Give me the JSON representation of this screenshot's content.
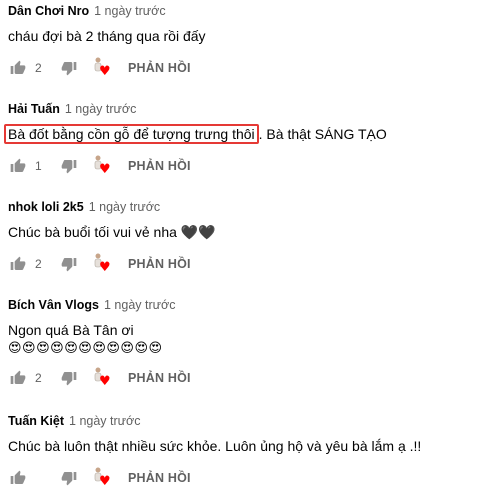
{
  "comments": [
    {
      "author": "Dân Chơi Nro",
      "time": "1 ngày trước",
      "text": "cháu đợi bà 2 tháng qua rồi đấy",
      "likes": "2",
      "reply_label": "PHẢN HỒI"
    },
    {
      "author": "Hải Tuấn",
      "time": "1 ngày trước",
      "text_highlighted": "Bà đốt bằng cồn  gỗ để tượng trưng thôi",
      "text_rest": ". Bà thật SÁNG TẠO",
      "highlight_color": "#e53935",
      "likes": "1",
      "reply_label": "PHẢN HỒI"
    },
    {
      "author": "nhok loli 2k5",
      "time": "1 ngày trước",
      "text": "Chúc bà buổi tối vui vẻ nha 🖤🖤",
      "likes": "2",
      "reply_label": "PHẢN HỒI"
    },
    {
      "author": "Bích Vân Vlogs",
      "time": "1 ngày trước",
      "text": "Ngon quá Bà Tân ơi",
      "emoji_line": "😍😍😍😍😍😍😍😍😍😍😍",
      "likes": "2",
      "reply_label": "PHẢN HỒI"
    },
    {
      "author": "Tuấn Kiệt",
      "time": "1 ngày trước",
      "text": "Chúc bà luôn thật nhiều sức khỏe. Luôn ủng hộ và yêu bà lắm ạ .!!",
      "reply_label": "PHẢN HỒI"
    }
  ],
  "icons": {
    "like": "thumb-up-icon",
    "dislike": "thumb-down-icon",
    "creator_heart": "creator-heart-icon"
  },
  "colors": {
    "heart": "#ff0000",
    "secondary_text": "#606060",
    "primary_text": "#030303"
  }
}
